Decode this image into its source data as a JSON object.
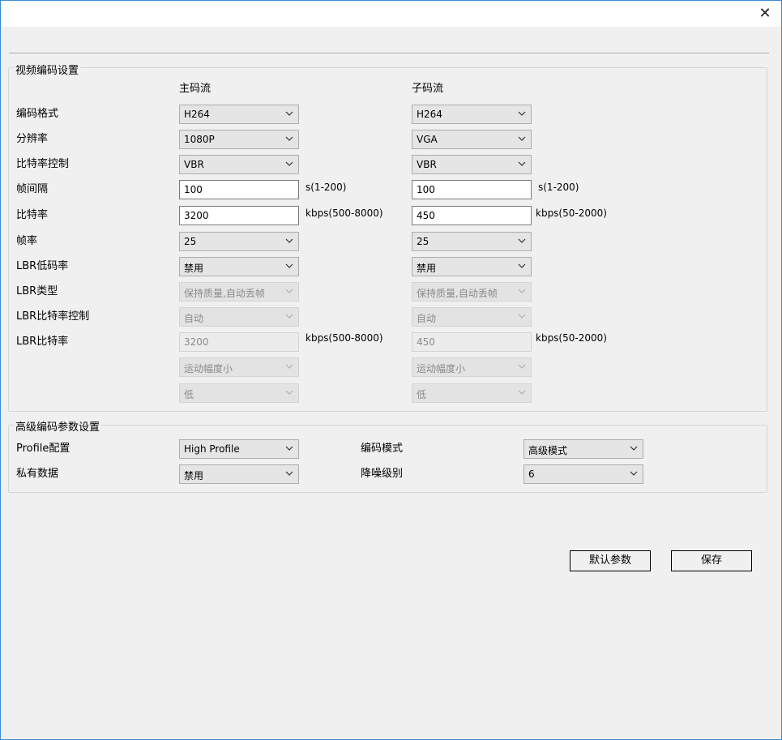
{
  "window": {
    "close_glyph": "✕"
  },
  "video": {
    "group_title": "视频编码设置",
    "col_main": "主码流",
    "col_sub": "子码流",
    "labels": [
      "编码格式",
      "分辨率",
      "比特率控制",
      "帧间隔",
      "比特率",
      "帧率",
      "LBR低码率",
      "LBR类型",
      "LBR比特率控制",
      "LBR比特率"
    ],
    "main": {
      "encode_format": "H264",
      "resolution": "1080P",
      "bitrate_control": "VBR",
      "frame_interval": "100",
      "frame_interval_unit": "s(1-200)",
      "bitrate": "3200",
      "bitrate_unit": "kbps(500-8000)",
      "framerate": "25",
      "lbr_low": "禁用",
      "lbr_type": "保持质量,自动丢帧",
      "lbr_bitrate_control": "自动",
      "lbr_bitrate": "3200",
      "lbr_bitrate_unit": "kbps(500-8000)",
      "motion": "运动幅度小",
      "level": "低"
    },
    "sub": {
      "encode_format": "H264",
      "resolution": "VGA",
      "bitrate_control": "VBR",
      "frame_interval": "100",
      "frame_interval_unit": "s(1-200)",
      "bitrate": "450",
      "bitrate_unit": "kbps(50-2000)",
      "framerate": "25",
      "lbr_low": "禁用",
      "lbr_type": "保持质量,自动丢帧",
      "lbr_bitrate_control": "自动",
      "lbr_bitrate": "450",
      "lbr_bitrate_unit": "kbps(50-2000)",
      "motion": "运动幅度小",
      "level": "低"
    }
  },
  "advanced": {
    "group_title": "高级编码参数设置",
    "profile_label": "Profile配置",
    "profile_value": "High Profile",
    "private_label": "私有数据",
    "private_value": "禁用",
    "mode_label": "编码模式",
    "mode_value": "高级模式",
    "noise_label": "降噪级别",
    "noise_value": "6"
  },
  "buttons": {
    "default": "默认参数",
    "save": "保存"
  }
}
